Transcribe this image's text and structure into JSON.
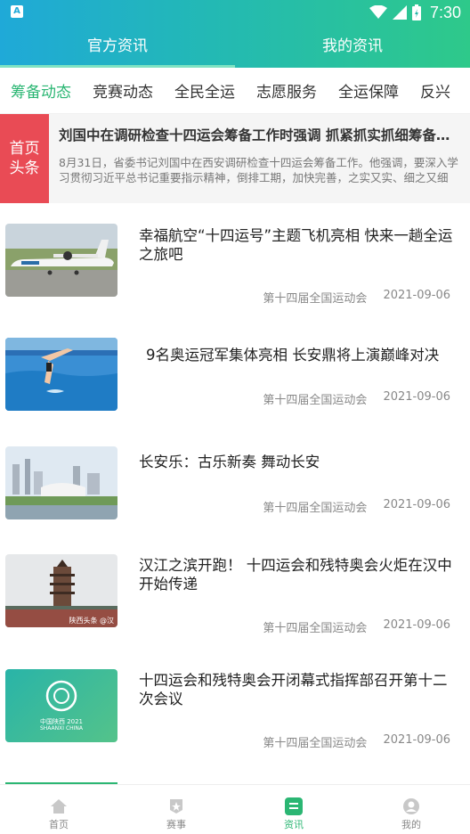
{
  "status_bar": {
    "time": "7:30",
    "app_icon": "A"
  },
  "top_tabs": [
    {
      "label": "官方资讯",
      "active": true
    },
    {
      "label": "我的资讯",
      "active": false
    }
  ],
  "categories": [
    {
      "label": "筹备动态",
      "active": true
    },
    {
      "label": "竞赛动态",
      "active": false
    },
    {
      "label": "全民全运",
      "active": false
    },
    {
      "label": "志愿服务",
      "active": false
    },
    {
      "label": "全运保障",
      "active": false
    },
    {
      "label": "反兴",
      "active": false
    }
  ],
  "headline": {
    "badge_line1": "首页",
    "badge_line2": "头条",
    "title": "刘国中在调研检查十四运会筹备工作时强调 抓紧抓实抓细筹备工作",
    "summary": "8月31日，省委书记刘国中在西安调研检查十四运会筹备工作。他强调，要深入学习贯彻习近平总书记重要指示精神，倒排工期，加快完善，之实又实、细之又细"
  },
  "news": [
    {
      "title": "幸福航空“十四运号”主题飞机亮相 快来一趟全运之旅吧",
      "source": "第十四届全国运动会",
      "date": "2021-09-06",
      "thumb": "airplane"
    },
    {
      "title": "9名奥运冠军集体亮相 长安鼎将上演巅峰对决",
      "source": "第十四届全国运动会",
      "date": "2021-09-06",
      "thumb": "diver"
    },
    {
      "title": "长安乐：古乐新奏 舞动长安",
      "source": "第十四届全国运动会",
      "date": "2021-09-06",
      "thumb": "city"
    },
    {
      "title": "汉江之滨开跑！ 十四运会和残特奥会火炬在汉中开始传递",
      "source": "第十四届全国运动会",
      "date": "2021-09-06",
      "thumb": "tower",
      "thumb_caption": "陕西头条 @汉"
    },
    {
      "title": "十四运会和残特奥会开闭幕式指挥部召开第十二次会议",
      "source": "第十四届全国运动会",
      "date": "2021-09-06",
      "thumb": "logo",
      "thumb_caption_1": "中国陕西 2021",
      "thumb_caption_2": "SHAANXI CHINA"
    }
  ],
  "bottom_nav": [
    {
      "label": "首页",
      "icon": "home-icon",
      "active": false
    },
    {
      "label": "赛事",
      "icon": "badge-icon",
      "active": false
    },
    {
      "label": "资讯",
      "icon": "news-icon",
      "active": true
    },
    {
      "label": "我的",
      "icon": "profile-icon",
      "active": false
    }
  ],
  "colors": {
    "accent": "#2bb673",
    "headline_badge": "#e94b55",
    "header_start": "#1fa9d8",
    "header_end": "#2ec98a"
  }
}
